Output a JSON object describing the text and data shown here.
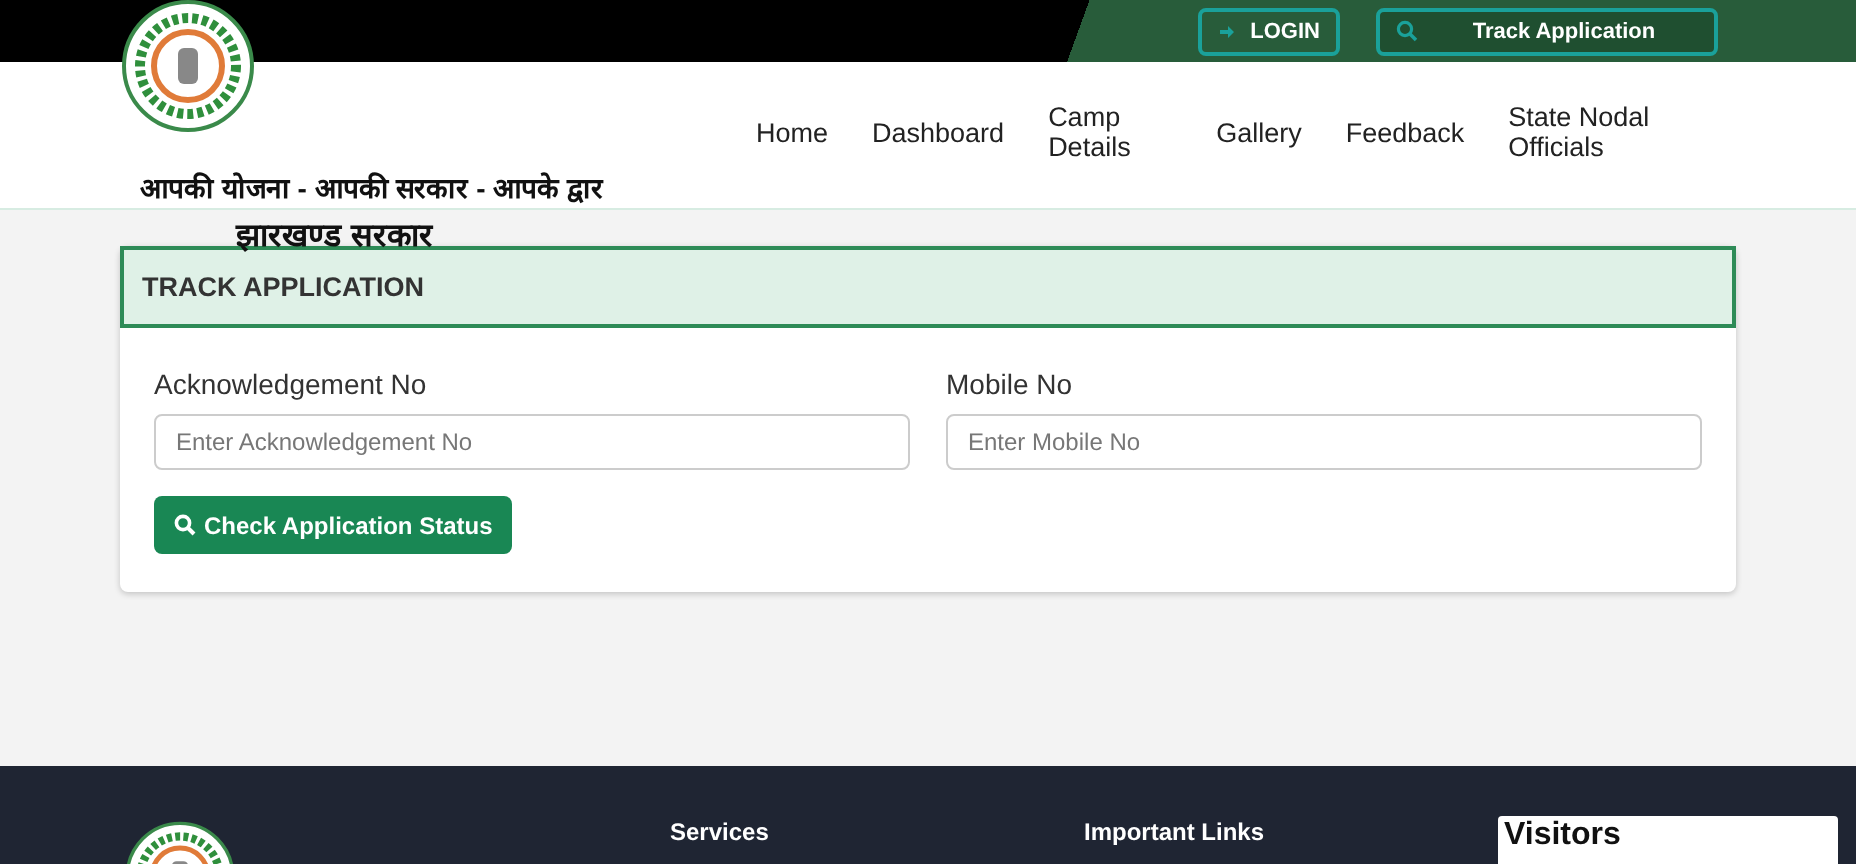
{
  "top_bar": {
    "login": "LOGIN",
    "track_application": "Track Application"
  },
  "nav": {
    "items": [
      {
        "label": "Home"
      },
      {
        "label": "Dashboard"
      },
      {
        "label": "Camp Details"
      },
      {
        "label": "Gallery"
      },
      {
        "label": "Feedback"
      },
      {
        "label": "State Nodal Officials"
      }
    ]
  },
  "tagline": "आपकी योजना - आपकी सरकार - आपके द्वार",
  "subtitle": "झारखण्ड सरकार",
  "card": {
    "title": "TRACK APPLICATION",
    "fields": [
      {
        "label": "Acknowledgement No",
        "placeholder": "Enter Acknowledgement No"
      },
      {
        "label": "Mobile No",
        "placeholder": "Enter Mobile No"
      }
    ],
    "button": "Check Application Status"
  },
  "footer": {
    "headings": [
      "Services",
      "Important Links"
    ],
    "visitors_title": "Visitors"
  }
}
